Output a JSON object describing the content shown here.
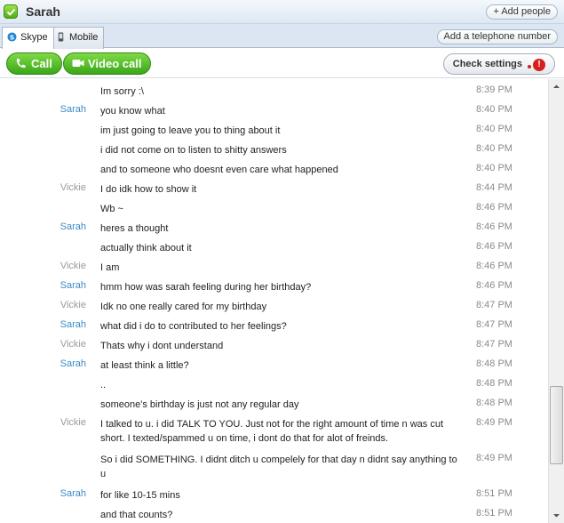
{
  "window": {
    "title": "Sarah"
  },
  "toolbar": {
    "add_people": "+ Add people",
    "add_phone": "Add a telephone number"
  },
  "tabs": [
    {
      "label": "Skype"
    },
    {
      "label": "Mobile"
    }
  ],
  "actions": {
    "call": "Call",
    "video_call": "Video call",
    "check_settings": "Check settings"
  },
  "colors": {
    "accent_green": "#3aa619",
    "sarah_name": "#3a8bc8",
    "vickie_name": "#9a9a9a"
  },
  "messages": [
    {
      "sender": "",
      "text": "Im sorry :\\",
      "time": "8:39 PM"
    },
    {
      "sender": "Sarah",
      "text": "you know what",
      "time": "8:40 PM"
    },
    {
      "sender": "",
      "text": "im just going to leave you to thing about it",
      "time": "8:40 PM"
    },
    {
      "sender": "",
      "text": "i did not come on to listen to shitty answers",
      "time": "8:40 PM"
    },
    {
      "sender": "",
      "text": "and to someone who doesnt even care what happened",
      "time": "8:40 PM"
    },
    {
      "sender": "Vickie",
      "text": "I do idk how to show it",
      "time": "8:44 PM"
    },
    {
      "sender": "",
      "text": "Wb ~",
      "time": "8:46 PM"
    },
    {
      "sender": "Sarah",
      "text": "heres a thought",
      "time": "8:46 PM"
    },
    {
      "sender": "",
      "text": "actually think about it",
      "time": "8:46 PM"
    },
    {
      "sender": "Vickie",
      "text": "I am",
      "time": "8:46 PM"
    },
    {
      "sender": "Sarah",
      "text": "hmm how was sarah feeling during her birthday?",
      "time": "8:46 PM"
    },
    {
      "sender": "Vickie",
      "text": "Idk no one really cared for my birthday",
      "time": "8:47 PM"
    },
    {
      "sender": "Sarah",
      "text": "what did i do to contributed to her feelings?",
      "time": "8:47 PM"
    },
    {
      "sender": "Vickie",
      "text": "Thats why i dont understand",
      "time": "8:47 PM"
    },
    {
      "sender": "Sarah",
      "text": "at least think a little?",
      "time": "8:48 PM"
    },
    {
      "sender": "",
      "text": "..",
      "time": "8:48 PM"
    },
    {
      "sender": "",
      "text": "someone's birthday is just not any regular day",
      "time": "8:48 PM"
    },
    {
      "sender": "Vickie",
      "text": "I talked to u. i did TALK TO YOU. Just not for the right amount of time n was cut short. I texted/spammed u on time, i dont do that for alot of freinds.",
      "time": "8:49 PM"
    },
    {
      "sender": "",
      "text": "So i did SOMETHING. I didnt ditch u compelely for that day n didnt say anything to u",
      "time": "8:49 PM"
    },
    {
      "sender": "Sarah",
      "text": "for like 10-15 mins",
      "time": "8:51 PM"
    },
    {
      "sender": "",
      "text": "and that counts?",
      "time": "8:51 PM"
    },
    {
      "sender": "",
      "text": "..",
      "time": "8:51 PM"
    }
  ]
}
